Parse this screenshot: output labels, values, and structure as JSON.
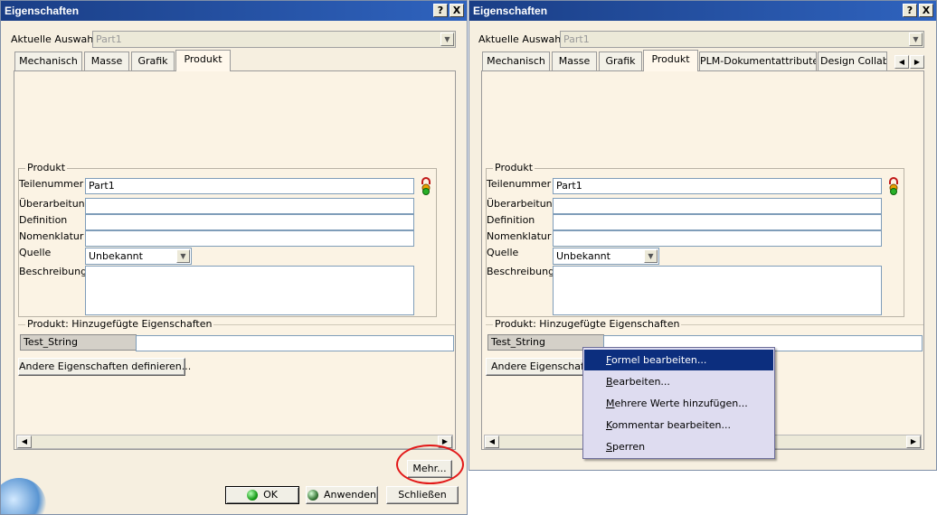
{
  "left": {
    "title": "Eigenschaften",
    "help_btn": "?",
    "close_btn": "X",
    "selection_label": "Aktuelle Auswahl:",
    "selection_value": "Part1",
    "tabs": [
      "Mechanisch",
      "Masse",
      "Grafik",
      "Produkt"
    ],
    "produkt_group": "Produkt",
    "fields": {
      "teilenummer_label": "Teilenummer",
      "teilenummer_value": "Part1",
      "ueberarbeitung_label": "Überarbeitung",
      "definition_label": "Definition",
      "nomenklatur_label": "Nomenklatur",
      "quelle_label": "Quelle",
      "quelle_value": "Unbekannt",
      "beschreibung_label": "Beschreibung"
    },
    "added_group": "Produkt: Hinzugefügte Eigenschaften",
    "test_string": "Test_String",
    "define_btn": "Andere Eigenschaften definieren...",
    "mehr_btn": "Mehr...",
    "ok_btn": "OK",
    "anwenden_btn": "Anwenden",
    "schliessen_btn": "Schließen"
  },
  "right": {
    "title": "Eigenschaften",
    "help_btn": "?",
    "close_btn": "X",
    "selection_label": "Aktuelle Auswahl:",
    "selection_value": "Part1",
    "tabs": [
      "Mechanisch",
      "Masse",
      "Grafik",
      "Produkt",
      "PLM-Dokumentattribute",
      "Design Collabor"
    ],
    "produkt_group": "Produkt",
    "fields": {
      "teilenummer_label": "Teilenummer",
      "teilenummer_value": "Part1",
      "ueberarbeitung_label": "Überarbeitung",
      "definition_label": "Definition",
      "nomenklatur_label": "Nomenklatur",
      "quelle_label": "Quelle",
      "quelle_value": "Unbekannt",
      "beschreibung_label": "Beschreibung"
    },
    "added_group": "Produkt: Hinzugefügte Eigenschaften",
    "test_string": "Test_String",
    "define_btn": "Andere Eigenschaften",
    "context_menu": [
      {
        "key": "F",
        "rest": "ormel bearbeiten..."
      },
      {
        "key": "B",
        "rest": "earbeiten..."
      },
      {
        "key": "M",
        "rest": "ehrere Werte hinzufügen..."
      },
      {
        "key": "K",
        "rest": "ommentar bearbeiten..."
      },
      {
        "key": "S",
        "rest": "perren"
      }
    ]
  },
  "icons": {
    "lock": "lock-status-icon",
    "ok_dot": "green-dot-icon",
    "apply_dot": "green-dot-icon"
  },
  "colors": {
    "titlebar": "#2f63be",
    "menu_highlight": "#0c2e7e",
    "annotation_circle": "#e21818"
  }
}
